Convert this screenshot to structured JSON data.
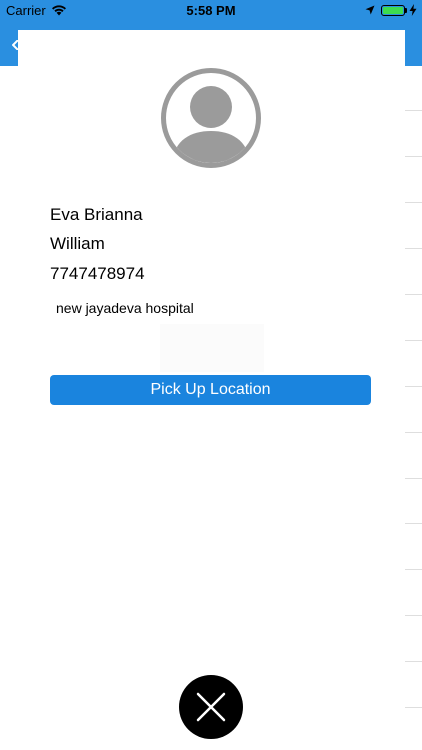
{
  "status_bar": {
    "carrier": "Carrier",
    "time": "5:58 PM",
    "battery_color": "#3ddc4f",
    "wifi_icon": "wifi-icon",
    "location_icon": "location-arrow-icon",
    "charging_icon": "bolt-icon"
  },
  "theme": {
    "nav_color": "#2a8fe0",
    "button_color": "#1a84de"
  },
  "profile": {
    "avatar_icon": "user-avatar-icon",
    "first_name": "Eva Brianna",
    "last_name": "William",
    "phone": "7747478974",
    "address": "new jayadeva hospital"
  },
  "actions": {
    "pickup_label": "Pick Up Location",
    "close_icon": "close-icon"
  }
}
